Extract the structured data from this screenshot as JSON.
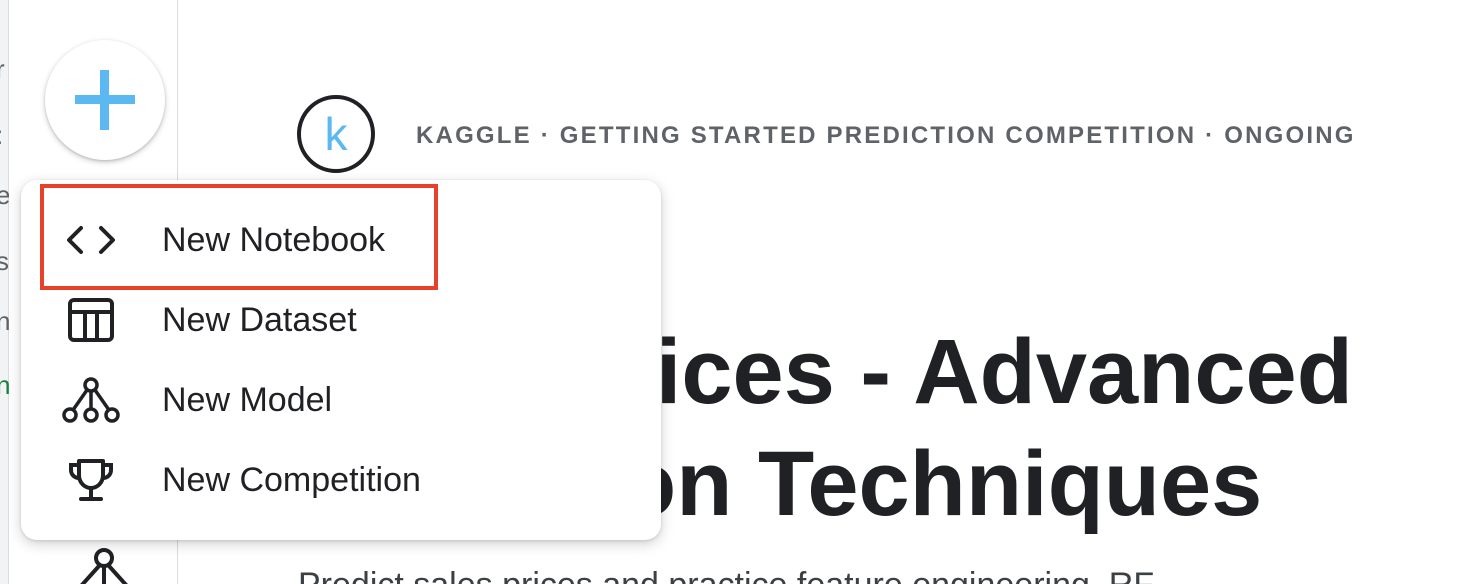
{
  "header": {
    "kicker": "KAGGLE · GETTING STARTED PREDICTION COMPETITION · ONGOING",
    "logo_letter": "k"
  },
  "main": {
    "title_line1": "rices - Advanced",
    "title_line2": "on Techniques",
    "subtitle": "Predict sales prices and practice feature engineering, RF"
  },
  "create_menu": {
    "items": [
      {
        "label": "New Notebook",
        "icon": "code-icon"
      },
      {
        "label": "New Dataset",
        "icon": "table-icon"
      },
      {
        "label": "New Model",
        "icon": "model-icon"
      },
      {
        "label": "New Competition",
        "icon": "trophy-icon"
      }
    ]
  },
  "colors": {
    "create_plus": "#5bb8f0",
    "highlight_border": "#e8412b",
    "logo_k": "#5bb8f0"
  }
}
